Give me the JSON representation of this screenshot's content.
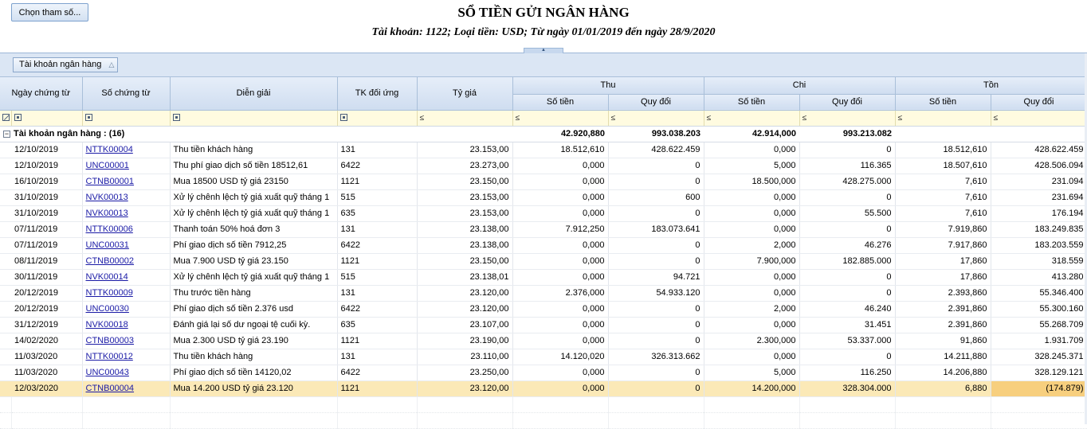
{
  "toolbar": {
    "param_button": "Chọn tham số..."
  },
  "report": {
    "title": "SỔ TIỀN GỬI NGÂN HÀNG",
    "subtitle": "Tài khoản: 1122; Loại tiền: USD; Từ ngày 01/01/2019 đến ngày 28/9/2020"
  },
  "group_panel": {
    "chip": "Tài khoản ngân hàng"
  },
  "columns": {
    "date": "Ngày chứng từ",
    "doc": "Số chứng từ",
    "desc": "Diễn giải",
    "acct": "TK đối ứng",
    "rate": "Tỷ giá",
    "thu": "Thu",
    "chi": "Chi",
    "ton": "Tồn",
    "amount": "Số tiền",
    "converted": "Quy đổi"
  },
  "filter": {
    "op": "≤"
  },
  "group": {
    "label": "Tài khoản ngân hàng : (16)",
    "thu_amount": "42.920,880",
    "thu_converted": "993.038.203",
    "chi_amount": "42.914,000",
    "chi_converted": "993.213.082"
  },
  "rows": [
    [
      "12/10/2019",
      "NTTK00004",
      "Thu tiền khách hàng",
      "131",
      "23.153,00",
      "18.512,610",
      "428.622.459",
      "0,000",
      "0",
      "18.512,610",
      "428.622.459"
    ],
    [
      "12/10/2019",
      "UNC00001",
      "Thu phí giao dịch số tiền 18512,61",
      "6422",
      "23.273,00",
      "0,000",
      "0",
      "5,000",
      "116.365",
      "18.507,610",
      "428.506.094"
    ],
    [
      "16/10/2019",
      "CTNB00001",
      "Mua 18500 USD tỷ giá 23150",
      "1121",
      "23.150,00",
      "0,000",
      "0",
      "18.500,000",
      "428.275.000",
      "7,610",
      "231.094"
    ],
    [
      "31/10/2019",
      "NVK00013",
      "Xử lý chênh lệch tỷ giá xuất quỹ tháng 1",
      "515",
      "23.153,00",
      "0,000",
      "600",
      "0,000",
      "0",
      "7,610",
      "231.694"
    ],
    [
      "31/10/2019",
      "NVK00013",
      "Xử lý chênh lệch tỷ giá xuất quỹ tháng 1",
      "635",
      "23.153,00",
      "0,000",
      "0",
      "0,000",
      "55.500",
      "7,610",
      "176.194"
    ],
    [
      "07/11/2019",
      "NTTK00006",
      "Thanh toán 50% hoá đơn 3",
      "131",
      "23.138,00",
      "7.912,250",
      "183.073.641",
      "0,000",
      "0",
      "7.919,860",
      "183.249.835"
    ],
    [
      "07/11/2019",
      "UNC00031",
      "Phí giao dịch số tiền 7912,25",
      "6422",
      "23.138,00",
      "0,000",
      "0",
      "2,000",
      "46.276",
      "7.917,860",
      "183.203.559"
    ],
    [
      "08/11/2019",
      "CTNB00002",
      "Mua 7.900 USD tỷ giá 23.150",
      "1121",
      "23.150,00",
      "0,000",
      "0",
      "7.900,000",
      "182.885.000",
      "17,860",
      "318.559"
    ],
    [
      "30/11/2019",
      "NVK00014",
      "Xử lý chênh lệch tỷ giá xuất quỹ tháng 1",
      "515",
      "23.138,01",
      "0,000",
      "94.721",
      "0,000",
      "0",
      "17,860",
      "413.280"
    ],
    [
      "20/12/2019",
      "NTTK00009",
      "Thu trước tiền hàng",
      "131",
      "23.120,00",
      "2.376,000",
      "54.933.120",
      "0,000",
      "0",
      "2.393,860",
      "55.346.400"
    ],
    [
      "20/12/2019",
      "UNC00030",
      "Phí giao dịch số tiền 2.376 usd",
      "6422",
      "23.120,00",
      "0,000",
      "0",
      "2,000",
      "46.240",
      "2.391,860",
      "55.300.160"
    ],
    [
      "31/12/2019",
      "NVK00018",
      "Đánh giá lại số dư ngoại tệ cuối kỳ.",
      "635",
      "23.107,00",
      "0,000",
      "0",
      "0,000",
      "31.451",
      "2.391,860",
      "55.268.709"
    ],
    [
      "14/02/2020",
      "CTNB00003",
      "Mua 2.300 USD tỷ giá 23.190",
      "1121",
      "23.190,00",
      "0,000",
      "0",
      "2.300,000",
      "53.337.000",
      "91,860",
      "1.931.709"
    ],
    [
      "11/03/2020",
      "NTTK00012",
      "Thu tiền khách hàng",
      "131",
      "23.110,00",
      "14.120,020",
      "326.313.662",
      "0,000",
      "0",
      "14.211,880",
      "328.245.371"
    ],
    [
      "11/03/2020",
      "UNC00043",
      "Phí giao dịch số tiền 14120,02",
      "6422",
      "23.250,00",
      "0,000",
      "0",
      "5,000",
      "116.250",
      "14.206,880",
      "328.129.121"
    ],
    [
      "12/03/2020",
      "CTNB00004",
      "Mua 14.200 USD tỷ giá 23.120",
      "1121",
      "23.120,00",
      "0,000",
      "0",
      "14.200,000",
      "328.304.000",
      "6,880",
      "(174.879)"
    ]
  ],
  "selected_row_index": 15
}
